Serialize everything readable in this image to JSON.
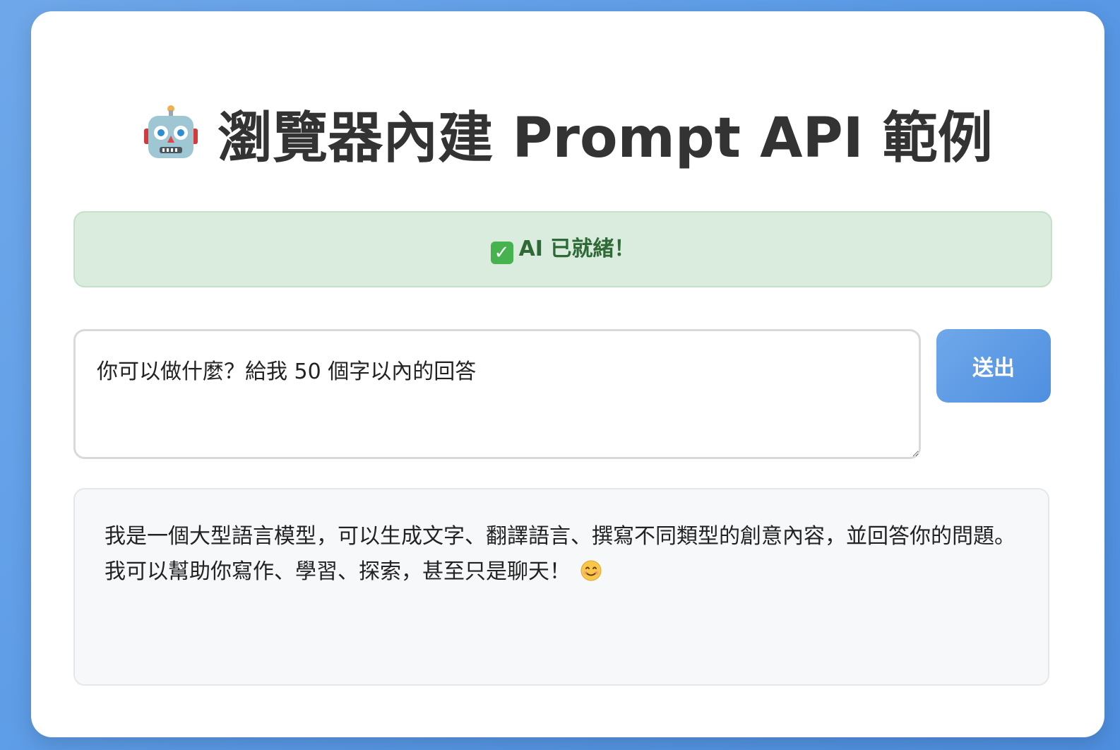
{
  "header": {
    "icon": "robot-icon",
    "title": "瀏覽器內建 Prompt API 範例"
  },
  "status": {
    "icon": "check-icon",
    "text": "AI 已就緒！"
  },
  "prompt": {
    "value": "你可以做什麼？給我 50 個字以內的回答"
  },
  "send_button": {
    "label": "送出"
  },
  "response": {
    "text": "我是一個大型語言模型，可以生成文字、翻譯語言、撰寫不同類型的創意內容，並回答你的問題。我可以幫助你寫作、學習、探索，甚至只是聊天！",
    "trailing_icon": "smiling-face-icon"
  },
  "colors": {
    "background": "#5a9ae6",
    "status_bg": "#d9ecdd",
    "status_text": "#2f6a36",
    "button": "#4f8fe0"
  }
}
